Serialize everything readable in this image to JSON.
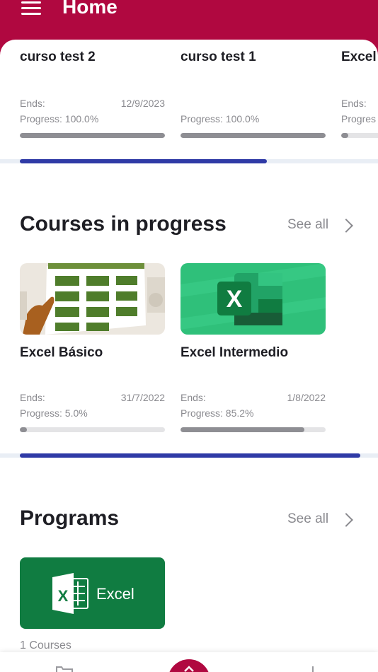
{
  "header": {
    "title": "Home",
    "menu_icon": "hamburger-menu-icon"
  },
  "enrolled": [
    {
      "title": "curso test 2",
      "ends_label": "Ends:",
      "ends_date": "12/9/2023",
      "progress_label": "Progress: 100.0%",
      "progress": 100
    },
    {
      "title": "curso test 1",
      "ends_label": "",
      "ends_date": "",
      "progress_label": "Progress: 100.0%",
      "progress": 100
    },
    {
      "title": "Excel",
      "ends_label": "Ends:",
      "ends_date": "",
      "progress_label": "Progres",
      "progress": 5
    }
  ],
  "enrolled_scroll": {
    "thumb_fraction": 0.69
  },
  "in_progress": {
    "title": "Courses in progress",
    "see_all": "See all",
    "items": [
      {
        "title": "Excel Básico",
        "ends_label": "Ends:",
        "ends_date": "31/7/2022",
        "progress_label": "Progress: 5.0%",
        "progress": 5.0,
        "thumb_icon": "spreadsheet-illustration"
      },
      {
        "title": "Excel Intermedio",
        "ends_label": "Ends:",
        "ends_date": "1/8/2022",
        "progress_label": "Progress: 85.2%",
        "progress": 85.2,
        "thumb_icon": "excel-logo-icon",
        "thumb_letter": "X"
      }
    ]
  },
  "in_progress_scroll": {
    "thumb_fraction": 0.95
  },
  "programs": {
    "title": "Programs",
    "see_all": "See all",
    "items": [
      {
        "name": "Excel",
        "letter": "X",
        "count": "1 Courses"
      }
    ]
  },
  "colors": {
    "brand": "#b00840",
    "scroll_thumb": "#2f3aa6",
    "excel_green": "#107c41"
  }
}
